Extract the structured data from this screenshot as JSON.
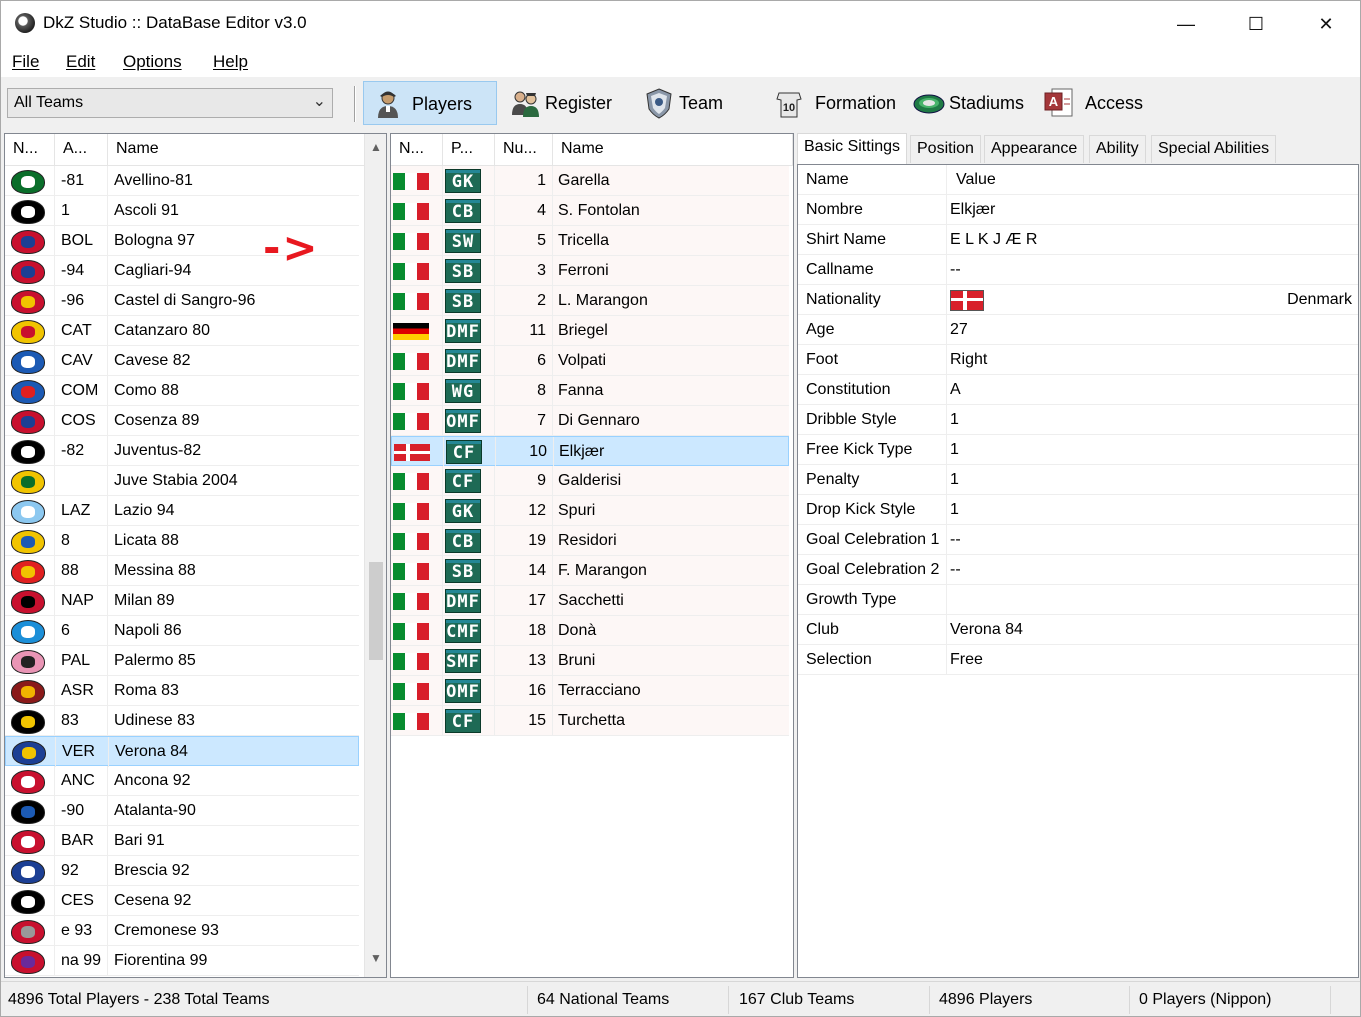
{
  "window": {
    "title": "DkZ Studio :: DataBase Editor v3.0",
    "controls": {
      "minimize": "—",
      "maximize": "☐",
      "close": "✕"
    }
  },
  "menu": [
    "File",
    "Edit",
    "Options",
    "Help"
  ],
  "toolbar": {
    "team_filter": "All Teams",
    "buttons": [
      {
        "label": "Players",
        "icon": "player-icon",
        "active": true
      },
      {
        "label": "Register",
        "icon": "register-icon"
      },
      {
        "label": "Team",
        "icon": "team-icon"
      },
      {
        "label": "Formation",
        "icon": "formation-icon"
      },
      {
        "label": "Stadiums",
        "icon": "stadium-icon"
      },
      {
        "label": "Access",
        "icon": "access-icon"
      }
    ]
  },
  "teams_list": {
    "headers": [
      "N...",
      "A...",
      "Name"
    ],
    "rows": [
      {
        "abbr": "-81",
        "name": "Avellino-81",
        "colors": [
          "#0a6e2a",
          "#ffffff"
        ]
      },
      {
        "abbr": "1",
        "name": "Ascoli 91",
        "colors": [
          "#000000",
          "#ffffff"
        ]
      },
      {
        "abbr": "BOL",
        "name": "Bologna 97",
        "colors": [
          "#c8102e",
          "#1c3f94"
        ]
      },
      {
        "abbr": "-94",
        "name": "Cagliari-94",
        "colors": [
          "#c8102e",
          "#1c3f94"
        ]
      },
      {
        "abbr": "-96",
        "name": "Castel di Sangro-96",
        "colors": [
          "#c8102e",
          "#f1c400"
        ]
      },
      {
        "abbr": "CAT",
        "name": "Catanzaro 80",
        "colors": [
          "#f1c400",
          "#c8102e"
        ]
      },
      {
        "abbr": "CAV",
        "name": "Cavese 82",
        "colors": [
          "#1c5ab4",
          "#ffffff"
        ]
      },
      {
        "abbr": "COM",
        "name": "Como 88",
        "colors": [
          "#1c5ab4",
          "#e02020"
        ]
      },
      {
        "abbr": "COS",
        "name": "Cosenza 89",
        "colors": [
          "#c8102e",
          "#1c3f94"
        ]
      },
      {
        "abbr": "-82",
        "name": "Juventus-82",
        "colors": [
          "#000000",
          "#ffffff"
        ]
      },
      {
        "abbr": "",
        "name": "Juve Stabia 2004",
        "colors": [
          "#f1c400",
          "#0a6e2a"
        ]
      },
      {
        "abbr": "LAZ",
        "name": "Lazio 94",
        "colors": [
          "#8cc8f0",
          "#ffffff"
        ]
      },
      {
        "abbr": "8",
        "name": "Licata 88",
        "colors": [
          "#f1c400",
          "#1c5ab4"
        ]
      },
      {
        "abbr": "88",
        "name": "Messina 88",
        "colors": [
          "#e02020",
          "#f1c400"
        ]
      },
      {
        "abbr": "NAP",
        "name": "Milan 89",
        "colors": [
          "#c8102e",
          "#000000"
        ]
      },
      {
        "abbr": "6",
        "name": "Napoli 86",
        "colors": [
          "#1c8fd8",
          "#ffffff"
        ]
      },
      {
        "abbr": "PAL",
        "name": "Palermo 85",
        "colors": [
          "#e995b5",
          "#222222"
        ]
      },
      {
        "abbr": "ASR",
        "name": "Roma 83",
        "colors": [
          "#8a1a1a",
          "#f1b400"
        ]
      },
      {
        "abbr": "83",
        "name": "Udinese 83",
        "colors": [
          "#000000",
          "#f1c400"
        ]
      },
      {
        "abbr": "VER",
        "name": "Verona 84",
        "colors": [
          "#1c3f94",
          "#f1c400"
        ],
        "selected": true
      },
      {
        "abbr": "ANC",
        "name": "Ancona 92",
        "colors": [
          "#c8102e",
          "#ffffff"
        ]
      },
      {
        "abbr": "-90",
        "name": "Atalanta-90",
        "colors": [
          "#000000",
          "#1c5ab4"
        ]
      },
      {
        "abbr": "BAR",
        "name": "Bari 91",
        "colors": [
          "#c8102e",
          "#ffffff"
        ]
      },
      {
        "abbr": "92",
        "name": "Brescia 92",
        "colors": [
          "#1c3f94",
          "#ffffff"
        ]
      },
      {
        "abbr": "CES",
        "name": "Cesena 92",
        "colors": [
          "#000000",
          "#ffffff"
        ]
      },
      {
        "abbr": "e 93",
        "name": "Cremonese 93",
        "colors": [
          "#c8102e",
          "#999999"
        ]
      },
      {
        "abbr": "na 99",
        "name": "Fiorentina 99",
        "colors": [
          "#c8102e",
          "#6a2a9a"
        ]
      }
    ]
  },
  "annotation_arrow": "->",
  "players_list": {
    "headers": [
      "N...",
      "P...",
      "Nu...",
      "Name"
    ],
    "rows": [
      {
        "flag": "it",
        "pos": "GK",
        "num": "1",
        "name": "Garella"
      },
      {
        "flag": "it",
        "pos": "CB",
        "num": "4",
        "name": "S. Fontolan"
      },
      {
        "flag": "it",
        "pos": "SW",
        "num": "5",
        "name": "Tricella"
      },
      {
        "flag": "it",
        "pos": "SB",
        "num": "3",
        "name": "Ferroni"
      },
      {
        "flag": "it",
        "pos": "SB",
        "num": "2",
        "name": "L. Marangon"
      },
      {
        "flag": "de",
        "pos": "DMF",
        "num": "11",
        "name": "Briegel"
      },
      {
        "flag": "it",
        "pos": "DMF",
        "num": "6",
        "name": "Volpati"
      },
      {
        "flag": "it",
        "pos": "WG",
        "num": "8",
        "name": "Fanna"
      },
      {
        "flag": "it",
        "pos": "OMF",
        "num": "7",
        "name": "Di Gennaro"
      },
      {
        "flag": "dk",
        "pos": "CF",
        "num": "10",
        "name": "Elkjær",
        "selected": true
      },
      {
        "flag": "it",
        "pos": "CF",
        "num": "9",
        "name": "Galderisi"
      },
      {
        "flag": "it",
        "pos": "GK",
        "num": "12",
        "name": "Spuri"
      },
      {
        "flag": "it",
        "pos": "CB",
        "num": "19",
        "name": "Residori"
      },
      {
        "flag": "it",
        "pos": "SB",
        "num": "14",
        "name": "F. Marangon"
      },
      {
        "flag": "it",
        "pos": "DMF",
        "num": "17",
        "name": "Sacchetti"
      },
      {
        "flag": "it",
        "pos": "CMF",
        "num": "18",
        "name": "Donà"
      },
      {
        "flag": "it",
        "pos": "SMF",
        "num": "13",
        "name": "Bruni"
      },
      {
        "flag": "it",
        "pos": "OMF",
        "num": "16",
        "name": "Terracciano"
      },
      {
        "flag": "it",
        "pos": "CF",
        "num": "15",
        "name": "Turchetta"
      }
    ]
  },
  "detail": {
    "tabs": [
      "Basic Sittings",
      "Position",
      "Appearance",
      "Ability",
      "Special Abilities"
    ],
    "active_tab": "Basic Sittings",
    "header": {
      "key": "Name",
      "value": "Value"
    },
    "fields": [
      {
        "key": "Nombre",
        "value": "Elkjær"
      },
      {
        "key": "Shirt Name",
        "value": "E L K J Æ R"
      },
      {
        "key": "Callname",
        "value": "--"
      },
      {
        "key": "Nationality",
        "value": "Denmark",
        "flag": "dk"
      },
      {
        "key": "Age",
        "value": "27"
      },
      {
        "key": "Foot",
        "value": "Right"
      },
      {
        "key": "Constitution",
        "value": "A"
      },
      {
        "key": "Dribble Style",
        "value": "1"
      },
      {
        "key": "Free Kick Type",
        "value": "1"
      },
      {
        "key": "Penalty",
        "value": "1"
      },
      {
        "key": "Drop Kick Style",
        "value": "1"
      },
      {
        "key": "Goal Celebration 1",
        "value": "--"
      },
      {
        "key": "Goal Celebration 2",
        "value": "--"
      },
      {
        "key": "Growth Type",
        "value": ""
      },
      {
        "key": "Club",
        "value": "Verona 84"
      },
      {
        "key": "Selection",
        "value": "Free"
      }
    ]
  },
  "status": [
    "4896 Total Players  -  238 Total Teams",
    "64 National Teams",
    "167 Club Teams",
    "4896 Players",
    "0 Players (Nippon)"
  ],
  "colors": {
    "selection": "#cce8ff",
    "toolbar_active": "#cce4f7",
    "position_badge": "#1e6a55",
    "annotation_arrow": "#e8181f"
  }
}
